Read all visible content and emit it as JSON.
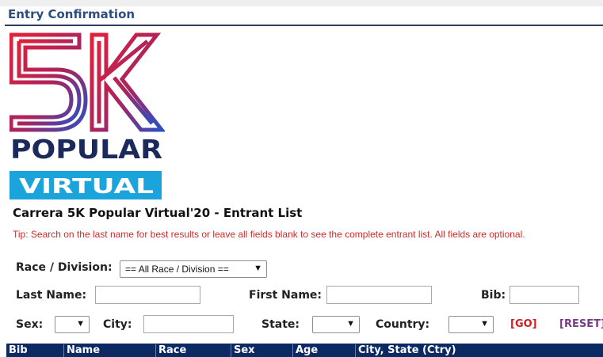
{
  "header": {
    "title": "Entry Confirmation"
  },
  "logo": {
    "five_k": "5K",
    "popular": "POPULAR",
    "virtual": "VIRTUAL"
  },
  "page_title": "Carrera 5K Popular Virtual'20 - Entrant List",
  "tip": "Tip: Search on the last name for best results or leave all fields blank to see the complete entrant list. All fields are optional.",
  "form": {
    "race_division_label": "Race / Division:",
    "race_division_value": "== All Race / Division ==",
    "last_name_label": "Last Name:",
    "last_name_value": "",
    "first_name_label": "First Name:",
    "first_name_value": "",
    "bib_label": "Bib:",
    "bib_value": "",
    "sex_label": "Sex:",
    "sex_value": "",
    "city_label": "City:",
    "city_value": "",
    "state_label": "State:",
    "state_value": "",
    "country_label": "Country:",
    "country_value": "",
    "go_label": "[GO]",
    "reset_label": "[RESET]",
    "arrow": "▼"
  },
  "table": {
    "columns": [
      "Bib",
      "Name",
      "Race",
      "Sex",
      "Age",
      "City, State (Ctry)"
    ]
  },
  "colors": {
    "navy": "#0b2a63",
    "logo_red": "#d81e3a",
    "logo_blue": "#2b57c7",
    "virtual_bg": "#1ba3db",
    "tip_red": "#d02a2a",
    "reset_purple": "#7a3a88"
  }
}
